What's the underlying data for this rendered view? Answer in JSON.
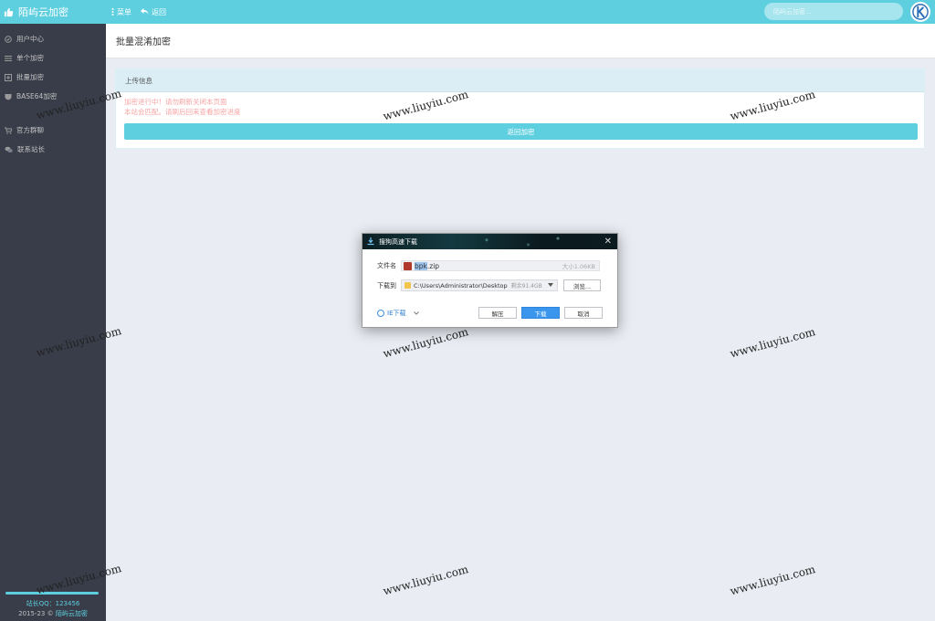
{
  "app": {
    "title": "陌屿云加密"
  },
  "toolbar": {
    "menu_label": "菜单",
    "back_label": "返回"
  },
  "search": {
    "placeholder": "陌屿云加密..."
  },
  "sidebar": {
    "items": [
      {
        "label": "用户中心",
        "icon": "user-circle-icon"
      },
      {
        "label": "单个加密",
        "icon": "list-icon"
      },
      {
        "label": "批量加密",
        "icon": "plus-square-icon"
      },
      {
        "label": "BASE64加密",
        "icon": "shield-icon"
      },
      {
        "label": "官方群聊",
        "icon": "cart-icon"
      },
      {
        "label": "联系站长",
        "icon": "chat-icon"
      }
    ],
    "footer": {
      "qq": "站长QQ：123456",
      "copyright_prefix": "2015-23 © ",
      "copyright_brand": "陌屿云加密"
    }
  },
  "page": {
    "title": "批量混淆加密"
  },
  "panel": {
    "title": "上传信息",
    "message_line1": "加密进行中！请勿刷新关闭本页面",
    "message_line2": "本站会匹配。请刷后回来查看加密进度",
    "back_button": "返回加密"
  },
  "watermark": {
    "text": "www.liuyiu.com"
  },
  "dialog": {
    "title": "搜狗高速下载",
    "close": "✕",
    "filename_label": "文件名",
    "filename_sel": "bpk",
    "filename_rest": ".zip",
    "size": "大小1.06KB",
    "saveto_label": "下载到",
    "path": "C:\\Users\\Administrator\\Desktop",
    "free_space": "剩余91.4GB",
    "browse_button": "浏览...",
    "ie_download": "IE下载",
    "extract_button": "解压",
    "download_button": "下载",
    "cancel_button": "取消"
  }
}
